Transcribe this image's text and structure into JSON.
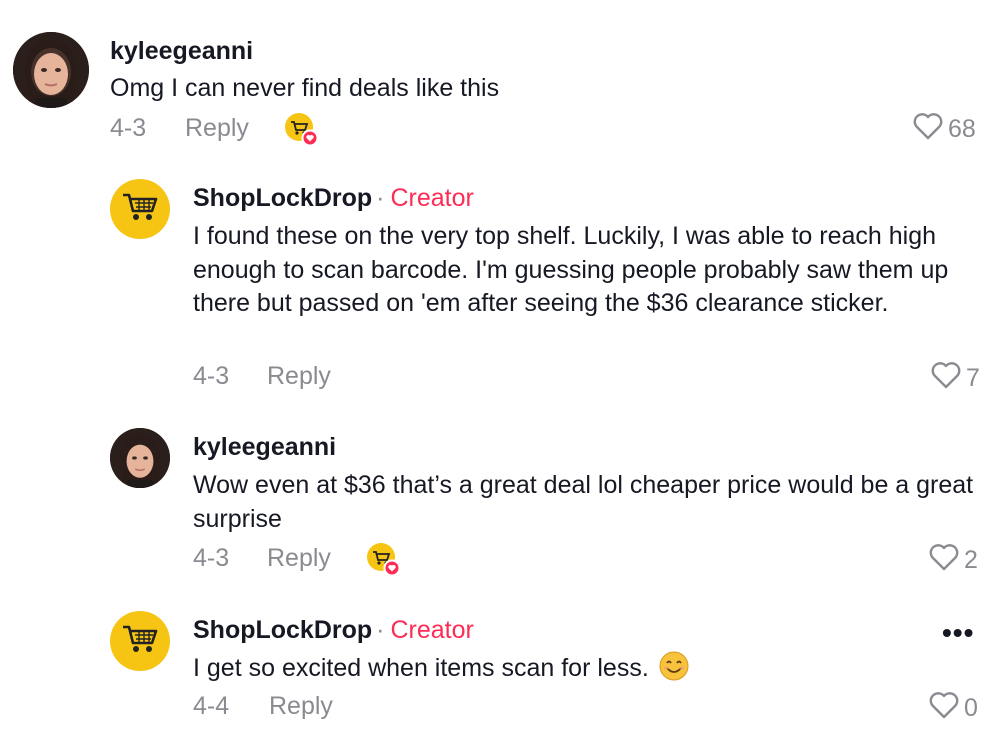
{
  "comments": [
    {
      "username": "kyleegeanni",
      "text": "Omg I can never find deals like this",
      "date": "4-3",
      "reply_label": "Reply",
      "likes": "68",
      "creator_liked": true
    },
    {
      "username": "ShopLockDrop",
      "dot": "·",
      "creator_label": "Creator",
      "text": "I found these on the very top shelf. Luckily, I was able to reach high enough to scan barcode. I'm guessing people probably saw them up there but passed on 'em after seeing the $36 clearance sticker.",
      "date": "4-3",
      "reply_label": "Reply",
      "likes": "7"
    },
    {
      "username": "kyleegeanni",
      "text": "Wow even at $36 that’s a great deal lol cheaper price would be a great surprise",
      "date": "4-3",
      "reply_label": "Reply",
      "likes": "2",
      "creator_liked": true
    },
    {
      "username": "ShopLockDrop",
      "dot": "·",
      "creator_label": "Creator",
      "text": "I get so excited when items scan for less.",
      "emoji": "smiling-face-emoji",
      "date": "4-4",
      "reply_label": "Reply",
      "likes": "0",
      "more": "•••"
    }
  ],
  "colors": {
    "creator": "#fe2c55",
    "meta": "#8a8b91",
    "text": "#161823",
    "shop_avatar": "#f6c514"
  },
  "icons": {
    "like": "heart-outline-icon",
    "creator_liked": "cart-avatar-with-heart-badge",
    "shop_avatar": "shopping-cart-icon",
    "more": "more-options-icon"
  }
}
